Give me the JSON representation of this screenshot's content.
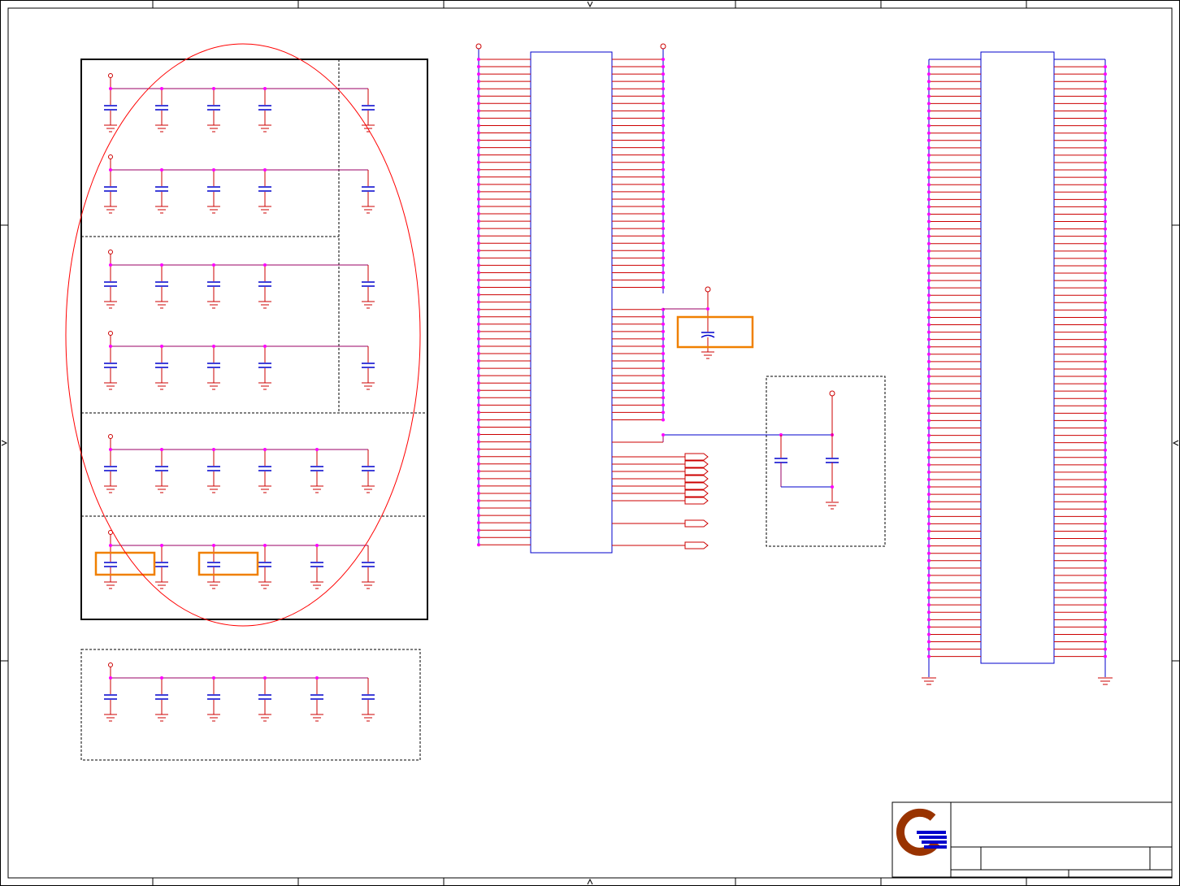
{
  "colors": {
    "wire": "#cc0000",
    "part": "#0000cc",
    "net": "#990066",
    "junction": "#ff00ff",
    "frame": "#000000",
    "dashed": "#000000",
    "highlight": "#f08000",
    "ellipse": "#ff0000",
    "logo_ring": "#993300",
    "logo_bars": "#0000cc"
  },
  "title_block": {
    "logo": "company-logo"
  }
}
